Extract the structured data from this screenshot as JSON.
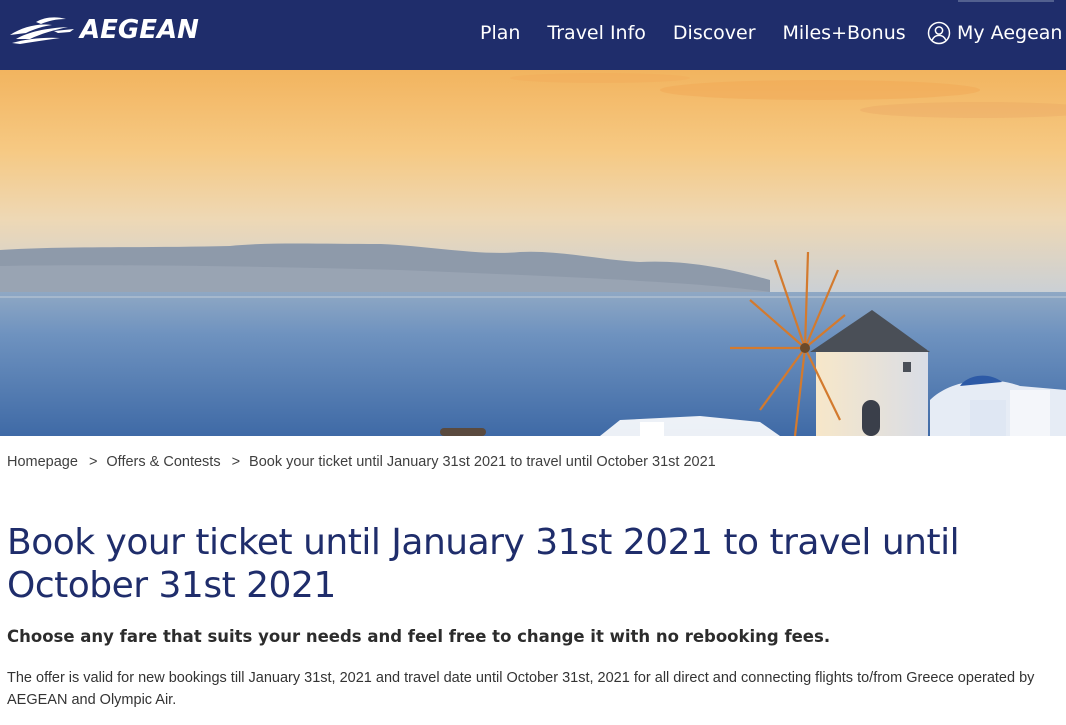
{
  "colors": {
    "header_bg": "#1f2d6b",
    "title": "#1f2d6b",
    "text": "#333333"
  },
  "header": {
    "logo_text": "AEGEAN",
    "logo_icon": "aegean-bird-logo",
    "nav": [
      "Plan",
      "Travel Info",
      "Discover",
      "Miles+Bonus"
    ],
    "account_label": "My Aegean",
    "account_icon": "user-icon"
  },
  "breadcrumb": {
    "items": [
      "Homepage",
      "Offers & Contests",
      "Book your ticket until January 31st 2021 to travel until October 31st 2021"
    ],
    "separator": ">"
  },
  "main": {
    "title": "Book your ticket until January 31st 2021 to travel until October 31st 2021",
    "subtitle": "Choose any fare that suits your needs and feel free to change it with no rebooking fees.",
    "body": "The offer is valid for new bookings till January 31st, 2021 and travel date until October 31st, 2021 for all direct and connecting flights to/from Greece operated by AEGEAN and Olympic Air."
  }
}
